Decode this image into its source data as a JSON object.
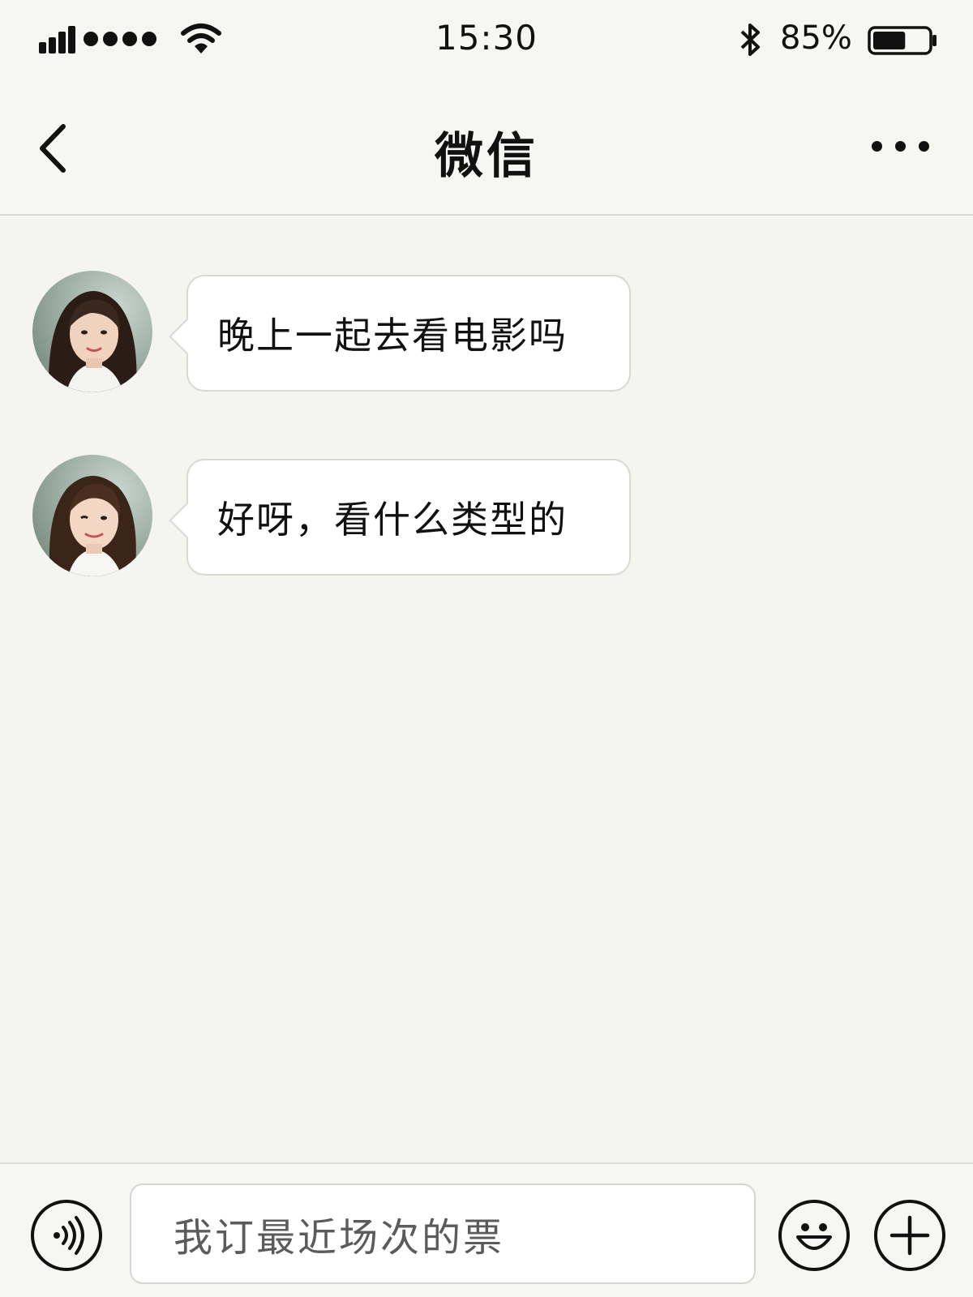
{
  "status_bar": {
    "time": "15:30",
    "battery_percent": "85%",
    "battery_level": 0.85,
    "icons": [
      "signal-icon",
      "signal-dots-icon",
      "wifi-icon",
      "bluetooth-icon",
      "battery-icon"
    ]
  },
  "nav": {
    "title": "微信",
    "back_icon": "chevron-left-icon",
    "more_icon": "more-dots-icon"
  },
  "messages": [
    {
      "sender": "contact",
      "avatar_icon": "avatar-woman",
      "text": "晚上一起去看电影吗"
    },
    {
      "sender": "contact",
      "avatar_icon": "avatar-woman",
      "text": "好呀，看什么类型的"
    }
  ],
  "input_bar": {
    "value": "我订最近场次的票",
    "voice_icon": "voice-icon",
    "emoji_icon": "smile-emoji-icon",
    "plus_icon": "plus-icon"
  }
}
